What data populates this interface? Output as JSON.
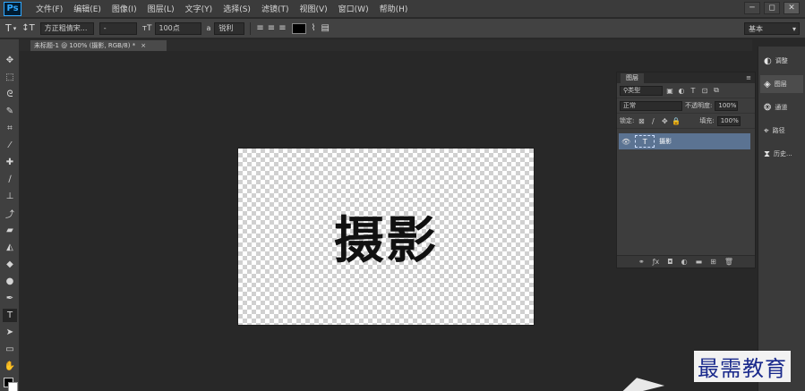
{
  "app": {
    "logo": "Ps"
  },
  "menu": [
    "文件(F)",
    "编辑(E)",
    "图像(I)",
    "图层(L)",
    "文字(Y)",
    "选择(S)",
    "滤镜(T)",
    "视图(V)",
    "窗口(W)",
    "帮助(H)"
  ],
  "window_controls": [
    "─",
    "◻",
    "✕"
  ],
  "options": {
    "font_family": "方正粗倩宋...",
    "font_style": "-",
    "font_size": "100点",
    "aa_label": "a",
    "aa_mode": "锐利",
    "workspace": "基本"
  },
  "document": {
    "tab_label": "未标题-1 @ 100% (摄影, RGB/8) *",
    "close_glyph": "×"
  },
  "canvas": {
    "text": "摄影"
  },
  "layers_panel": {
    "title": "图层",
    "filter_kind": "类型",
    "blend_mode": "正常",
    "opacity_label": "不透明度:",
    "opacity_value": "100%",
    "lock_label": "锁定:",
    "fill_label": "填充:",
    "fill_value": "100%",
    "layers": [
      {
        "name": "摄影",
        "type": "T"
      }
    ]
  },
  "dock": [
    {
      "label": "调整",
      "icon": "adjust-icon"
    },
    {
      "label": "图层",
      "icon": "layers-icon"
    },
    {
      "label": "通道",
      "icon": "channels-icon"
    },
    {
      "label": "路径",
      "icon": "paths-icon"
    },
    {
      "label": "历史...",
      "icon": "history-icon"
    }
  ],
  "watermark": "最需教育"
}
